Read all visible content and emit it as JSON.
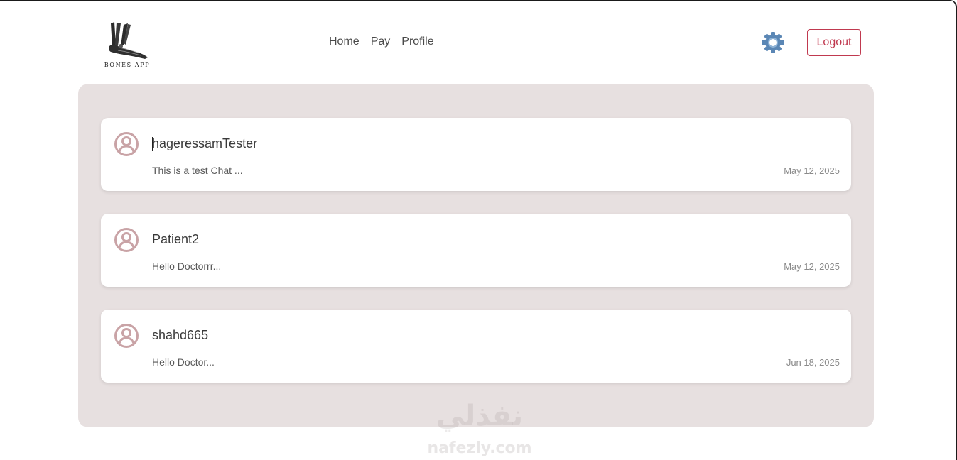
{
  "header": {
    "logo_text": "BONES APP",
    "nav": [
      {
        "label": "Home"
      },
      {
        "label": "Pay"
      },
      {
        "label": "Profile"
      }
    ],
    "settings_icon": "gear-icon",
    "logout_label": "Logout"
  },
  "chats": [
    {
      "name": "hageressamTester",
      "preview": "This is a test Chat ...",
      "date": "May 12, 2025",
      "icon": "user-circle-icon"
    },
    {
      "name": "Patient2",
      "preview": "Hello Doctorrr...",
      "date": "May 12, 2025",
      "icon": "user-circle-icon"
    },
    {
      "name": "shahd665",
      "preview": "Hello Doctor...",
      "date": "Jun 18, 2025",
      "icon": "user-circle-icon"
    }
  ],
  "watermark": {
    "arabic": "نفذلي",
    "latin": "nafezly.com"
  },
  "colors": {
    "accent": "#c0394f",
    "panel_bg": "#e7e0e0",
    "avatar": "#c9a3a6",
    "gear": "#5b87b5"
  }
}
